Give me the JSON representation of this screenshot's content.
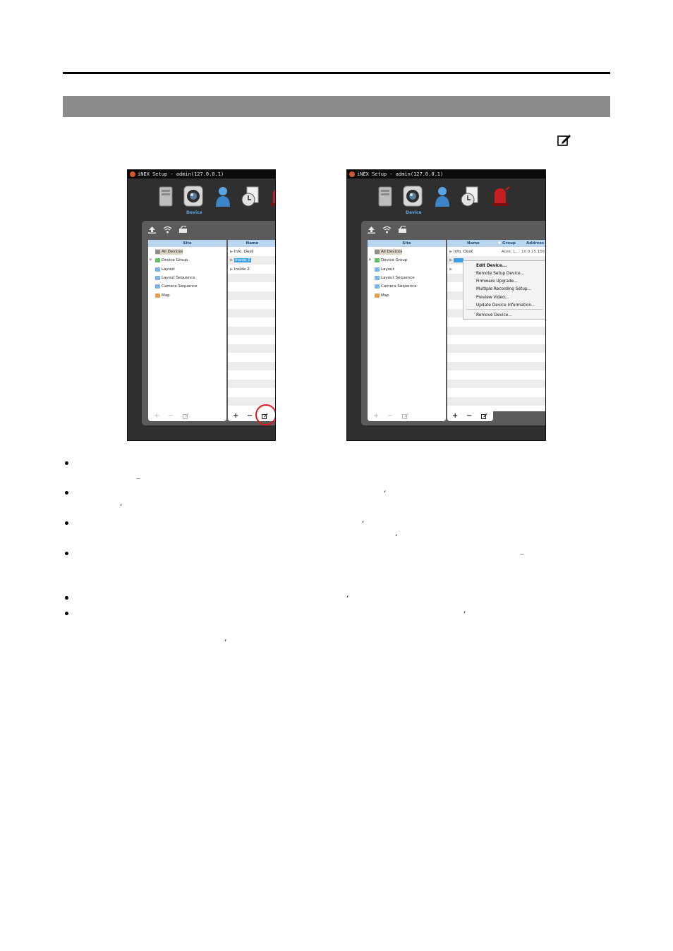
{
  "edit_icon": "edit-icon",
  "left_shot": {
    "title": "iNEX Setup - admin(127.0.0.1)",
    "active_tab_label": "Device",
    "tree_header": "Site",
    "tree_items": [
      "All Devices",
      "Device Group",
      "Layout",
      "Layout Sequence",
      "Camera Sequence",
      "Map"
    ],
    "list_header": "Name",
    "list_items": [
      "Info. Desk",
      "Inside 1",
      "Inside 2"
    ],
    "bottom_left_buttons": [
      "+",
      "−"
    ],
    "bottom_right_buttons": [
      "+",
      "−"
    ]
  },
  "right_shot": {
    "title": "iNEX Setup - admin(127.0.0.1)",
    "active_tab_label": "Device",
    "tree_header": "Site",
    "tree_items": [
      "All Devices",
      "Device Group",
      "Layout",
      "Layout Sequence",
      "Camera Sequence",
      "Map"
    ],
    "list_headers": [
      "Name",
      "Group",
      "Address"
    ],
    "first_row": {
      "name": "Info. Desk",
      "group": "Aisle, L...",
      "address": "10.0.15.156"
    },
    "context_menu": [
      "Edit Device...",
      "Remote Setup Device...",
      "Firmware Upgrade...",
      "Multiple Recording Setup...",
      "Preview Video...",
      "Update Device Information...",
      "Remove Device..."
    ],
    "bottom_left_buttons": [
      "+",
      "−"
    ],
    "bottom_right_buttons": [
      "+",
      "−"
    ]
  },
  "marks": {
    "comma": ",",
    "dash": "_"
  }
}
